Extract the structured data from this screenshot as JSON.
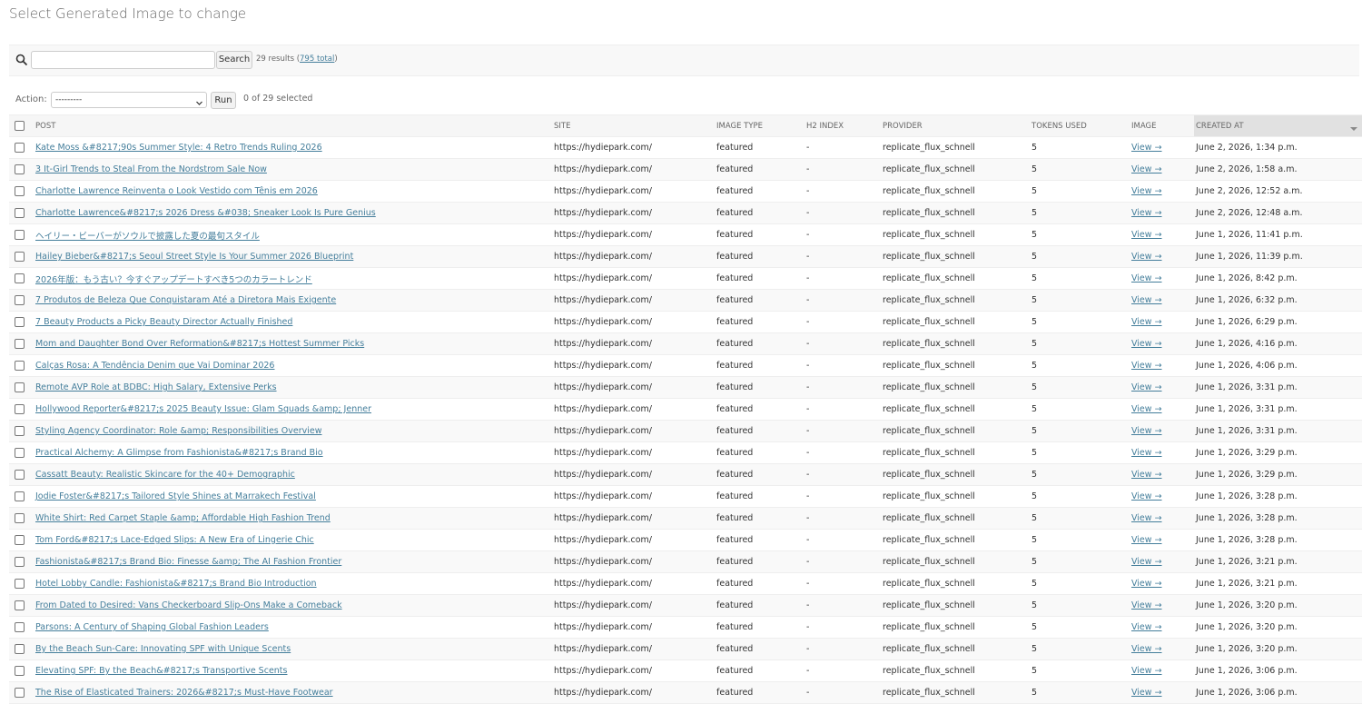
{
  "page_title": "Select Generated Image to change",
  "search": {
    "value": "",
    "placeholder": "",
    "button_label": "Search",
    "results_prefix": "29 results (",
    "total_link": "795 total",
    "results_suffix": ")"
  },
  "actions": {
    "label": "Action:",
    "selected_option": "---------",
    "run_label": "Run",
    "selected_text": "0 of 29 selected"
  },
  "columns": [
    "POST",
    "SITE",
    "IMAGE TYPE",
    "H2 INDEX",
    "PROVIDER",
    "TOKENS USED",
    "IMAGE",
    "CREATED AT"
  ],
  "rows": [
    {
      "post": "Kate Moss &#8217;90s Summer Style: 4 Retro Trends Ruling 2026",
      "site": "https://hydiepark.com/",
      "image_type": "featured",
      "h2_index": "-",
      "provider": "replicate_flux_schnell",
      "tokens": "5",
      "image": "View →",
      "created": "June 2, 2026, 1:34 p.m."
    },
    {
      "post": "3 It-Girl Trends to Steal From the Nordstrom Sale Now",
      "site": "https://hydiepark.com/",
      "image_type": "featured",
      "h2_index": "-",
      "provider": "replicate_flux_schnell",
      "tokens": "5",
      "image": "View →",
      "created": "June 2, 2026, 1:58 a.m."
    },
    {
      "post": "Charlotte Lawrence Reinventa o Look Vestido com Tênis em 2026",
      "site": "https://hydiepark.com/",
      "image_type": "featured",
      "h2_index": "-",
      "provider": "replicate_flux_schnell",
      "tokens": "5",
      "image": "View →",
      "created": "June 2, 2026, 12:52 a.m."
    },
    {
      "post": "Charlotte Lawrence&#8217;s 2026 Dress &#038; Sneaker Look Is Pure Genius",
      "site": "https://hydiepark.com/",
      "image_type": "featured",
      "h2_index": "-",
      "provider": "replicate_flux_schnell",
      "tokens": "5",
      "image": "View →",
      "created": "June 2, 2026, 12:48 a.m."
    },
    {
      "post": "ヘイリー・ビーバーがソウルで披露した夏の最旬スタイル",
      "site": "https://hydiepark.com/",
      "image_type": "featured",
      "h2_index": "-",
      "provider": "replicate_flux_schnell",
      "tokens": "5",
      "image": "View →",
      "created": "June 1, 2026, 11:41 p.m."
    },
    {
      "post": "Hailey Bieber&#8217;s Seoul Street Style Is Your Summer 2026 Blueprint",
      "site": "https://hydiepark.com/",
      "image_type": "featured",
      "h2_index": "-",
      "provider": "replicate_flux_schnell",
      "tokens": "5",
      "image": "View →",
      "created": "June 1, 2026, 11:39 p.m."
    },
    {
      "post": "2026年版：もう古い？今すぐアップデートすべき5つのカラートレンド",
      "site": "https://hydiepark.com/",
      "image_type": "featured",
      "h2_index": "-",
      "provider": "replicate_flux_schnell",
      "tokens": "5",
      "image": "View →",
      "created": "June 1, 2026, 8:42 p.m."
    },
    {
      "post": "7 Produtos de Beleza Que Conquistaram Até a Diretora Mais Exigente",
      "site": "https://hydiepark.com/",
      "image_type": "featured",
      "h2_index": "-",
      "provider": "replicate_flux_schnell",
      "tokens": "5",
      "image": "View →",
      "created": "June 1, 2026, 6:32 p.m."
    },
    {
      "post": "7 Beauty Products a Picky Beauty Director Actually Finished",
      "site": "https://hydiepark.com/",
      "image_type": "featured",
      "h2_index": "-",
      "provider": "replicate_flux_schnell",
      "tokens": "5",
      "image": "View →",
      "created": "June 1, 2026, 6:29 p.m."
    },
    {
      "post": "Mom and Daughter Bond Over Reformation&#8217;s Hottest Summer Picks",
      "site": "https://hydiepark.com/",
      "image_type": "featured",
      "h2_index": "-",
      "provider": "replicate_flux_schnell",
      "tokens": "5",
      "image": "View →",
      "created": "June 1, 2026, 4:16 p.m."
    },
    {
      "post": "Calças Rosa: A Tendência Denim que Vai Dominar 2026",
      "site": "https://hydiepark.com/",
      "image_type": "featured",
      "h2_index": "-",
      "provider": "replicate_flux_schnell",
      "tokens": "5",
      "image": "View →",
      "created": "June 1, 2026, 4:06 p.m."
    },
    {
      "post": "Remote AVP Role at BDBC: High Salary, Extensive Perks",
      "site": "https://hydiepark.com/",
      "image_type": "featured",
      "h2_index": "-",
      "provider": "replicate_flux_schnell",
      "tokens": "5",
      "image": "View →",
      "created": "June 1, 2026, 3:31 p.m."
    },
    {
      "post": "Hollywood Reporter&#8217;s 2025 Beauty Issue: Glam Squads &amp; Jenner",
      "site": "https://hydiepark.com/",
      "image_type": "featured",
      "h2_index": "-",
      "provider": "replicate_flux_schnell",
      "tokens": "5",
      "image": "View →",
      "created": "June 1, 2026, 3:31 p.m."
    },
    {
      "post": "Styling Agency Coordinator: Role &amp; Responsibilities Overview",
      "site": "https://hydiepark.com/",
      "image_type": "featured",
      "h2_index": "-",
      "provider": "replicate_flux_schnell",
      "tokens": "5",
      "image": "View →",
      "created": "June 1, 2026, 3:31 p.m."
    },
    {
      "post": "Practical Alchemy: A Glimpse from Fashionista&#8217;s Brand Bio",
      "site": "https://hydiepark.com/",
      "image_type": "featured",
      "h2_index": "-",
      "provider": "replicate_flux_schnell",
      "tokens": "5",
      "image": "View →",
      "created": "June 1, 2026, 3:29 p.m."
    },
    {
      "post": "Cassatt Beauty: Realistic Skincare for the 40+ Demographic",
      "site": "https://hydiepark.com/",
      "image_type": "featured",
      "h2_index": "-",
      "provider": "replicate_flux_schnell",
      "tokens": "5",
      "image": "View →",
      "created": "June 1, 2026, 3:29 p.m."
    },
    {
      "post": "Jodie Foster&#8217;s Tailored Style Shines at Marrakech Festival",
      "site": "https://hydiepark.com/",
      "image_type": "featured",
      "h2_index": "-",
      "provider": "replicate_flux_schnell",
      "tokens": "5",
      "image": "View →",
      "created": "June 1, 2026, 3:28 p.m."
    },
    {
      "post": "White Shirt: Red Carpet Staple &amp; Affordable High Fashion Trend",
      "site": "https://hydiepark.com/",
      "image_type": "featured",
      "h2_index": "-",
      "provider": "replicate_flux_schnell",
      "tokens": "5",
      "image": "View →",
      "created": "June 1, 2026, 3:28 p.m."
    },
    {
      "post": "Tom Ford&#8217;s Lace-Edged Slips: A New Era of Lingerie Chic",
      "site": "https://hydiepark.com/",
      "image_type": "featured",
      "h2_index": "-",
      "provider": "replicate_flux_schnell",
      "tokens": "5",
      "image": "View →",
      "created": "June 1, 2026, 3:28 p.m."
    },
    {
      "post": "Fashionista&#8217;s Brand Bio: Finesse &amp; The AI Fashion Frontier",
      "site": "https://hydiepark.com/",
      "image_type": "featured",
      "h2_index": "-",
      "provider": "replicate_flux_schnell",
      "tokens": "5",
      "image": "View →",
      "created": "June 1, 2026, 3:21 p.m."
    },
    {
      "post": "Hotel Lobby Candle: Fashionista&#8217;s Brand Bio Introduction",
      "site": "https://hydiepark.com/",
      "image_type": "featured",
      "h2_index": "-",
      "provider": "replicate_flux_schnell",
      "tokens": "5",
      "image": "View →",
      "created": "June 1, 2026, 3:21 p.m."
    },
    {
      "post": "From Dated to Desired: Vans Checkerboard Slip-Ons Make a Comeback",
      "site": "https://hydiepark.com/",
      "image_type": "featured",
      "h2_index": "-",
      "provider": "replicate_flux_schnell",
      "tokens": "5",
      "image": "View →",
      "created": "June 1, 2026, 3:20 p.m."
    },
    {
      "post": "Parsons: A Century of Shaping Global Fashion Leaders",
      "site": "https://hydiepark.com/",
      "image_type": "featured",
      "h2_index": "-",
      "provider": "replicate_flux_schnell",
      "tokens": "5",
      "image": "View →",
      "created": "June 1, 2026, 3:20 p.m."
    },
    {
      "post": "By the Beach Sun-Care: Innovating SPF with Unique Scents",
      "site": "https://hydiepark.com/",
      "image_type": "featured",
      "h2_index": "-",
      "provider": "replicate_flux_schnell",
      "tokens": "5",
      "image": "View →",
      "created": "June 1, 2026, 3:20 p.m."
    },
    {
      "post": "Elevating SPF: By the Beach&#8217;s Transportive Scents",
      "site": "https://hydiepark.com/",
      "image_type": "featured",
      "h2_index": "-",
      "provider": "replicate_flux_schnell",
      "tokens": "5",
      "image": "View →",
      "created": "June 1, 2026, 3:06 p.m."
    },
    {
      "post": "The Rise of Elasticated Trainers: 2026&#8217;s Must-Have Footwear",
      "site": "https://hydiepark.com/",
      "image_type": "featured",
      "h2_index": "-",
      "provider": "replicate_flux_schnell",
      "tokens": "5",
      "image": "View →",
      "created": "June 1, 2026, 3:06 p.m."
    }
  ]
}
